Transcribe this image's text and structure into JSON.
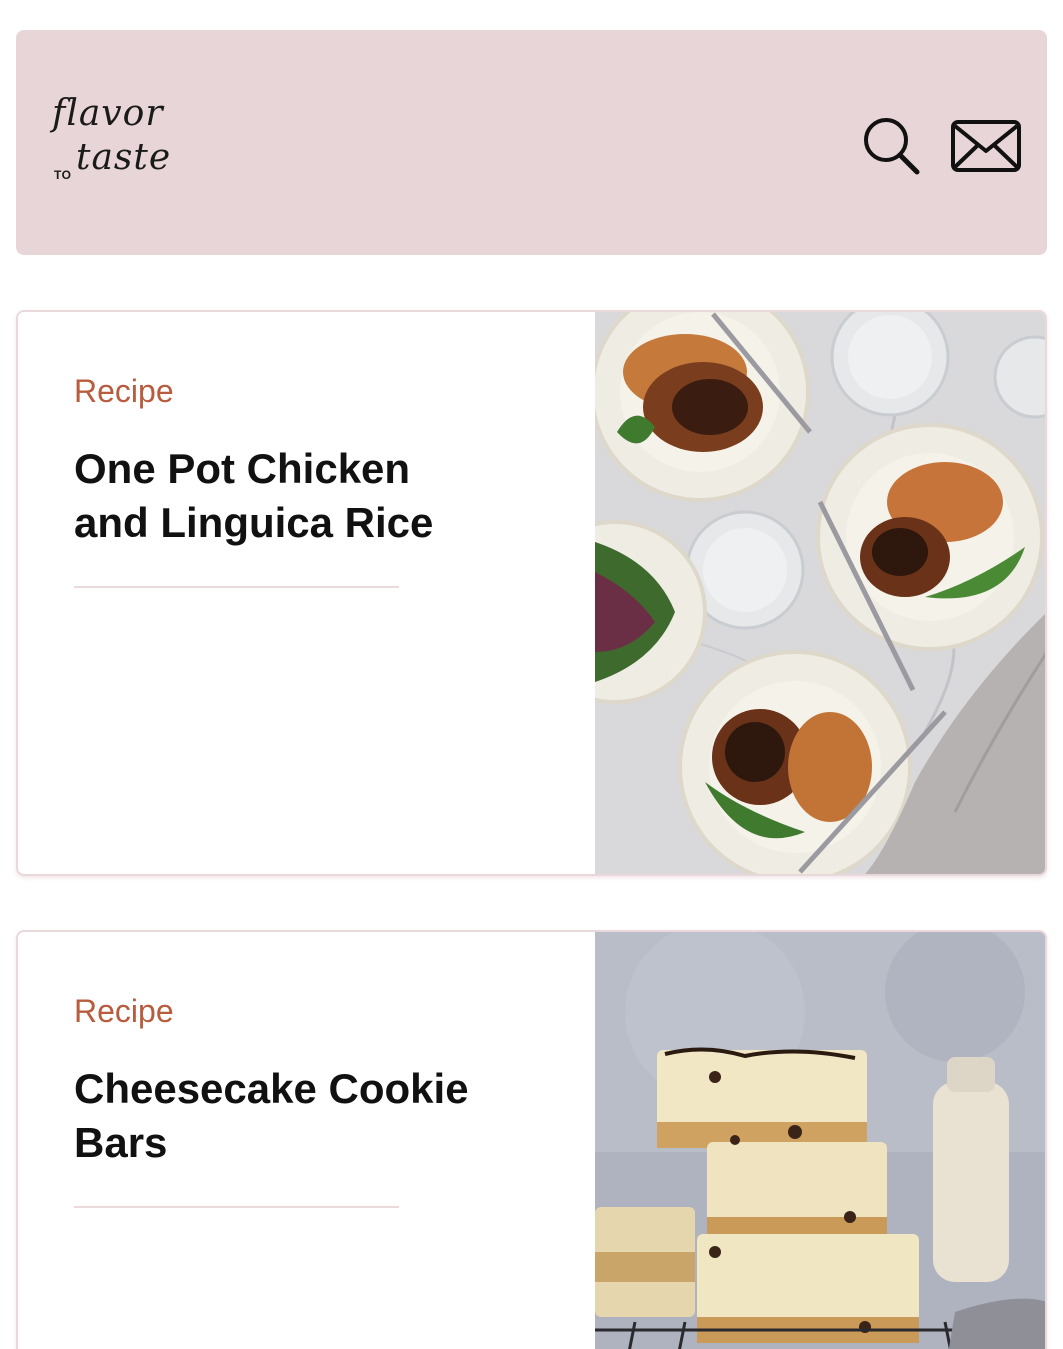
{
  "header": {
    "logo": {
      "line1": "flavor",
      "small": "TO",
      "line2": "taste"
    },
    "search_icon": "search-icon",
    "mail_icon": "mail-icon",
    "background": "#e8d5d7"
  },
  "cards": [
    {
      "category": "Recipe",
      "title": "One Pot Chicken and Linguica Rice"
    },
    {
      "category": "Recipe",
      "title": "Cheesecake Cookie Bars"
    }
  ],
  "colors": {
    "accent": "#b85c3e",
    "divider": "#ecdadb",
    "card_border": "#ead9db"
  }
}
